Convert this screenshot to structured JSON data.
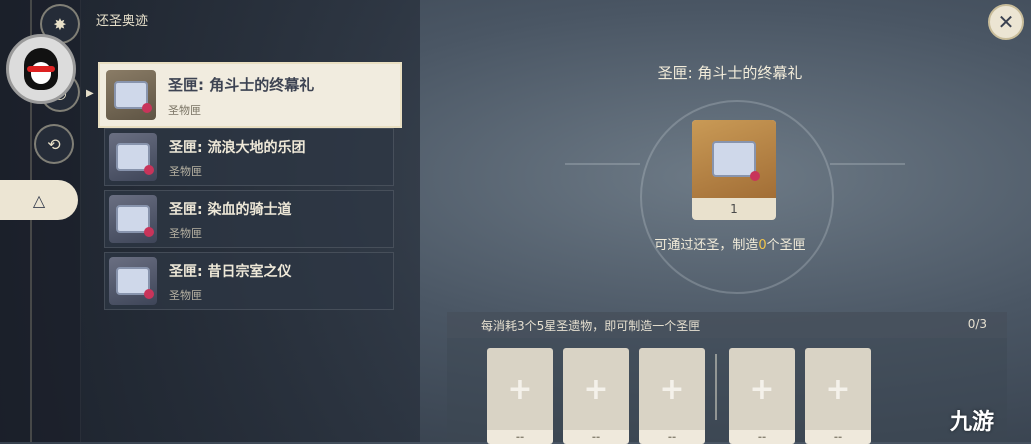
{
  "page": {
    "title": "还圣奥迹"
  },
  "list": [
    {
      "name": "圣匣: 角斗士的终幕礼",
      "type": "圣物匣",
      "selected": true
    },
    {
      "name": "圣匣: 流浪大地的乐团",
      "type": "圣物匣",
      "selected": false
    },
    {
      "name": "圣匣: 染血的骑士道",
      "type": "圣物匣",
      "selected": false
    },
    {
      "name": "圣匣: 昔日宗室之仪",
      "type": "圣物匣",
      "selected": false
    }
  ],
  "detail": {
    "title": "圣匣: 角斗士的终幕礼",
    "count": "1",
    "craft_prefix": "可通过还圣，制造",
    "craft_num": "0",
    "craft_suffix": "个圣匣"
  },
  "requirement": {
    "text": "每消耗3个5星圣遗物，即可制造一个圣匣",
    "progress": "0/3"
  },
  "slots": [
    {
      "symbol": "+",
      "label": "--"
    },
    {
      "symbol": "+",
      "label": "--"
    },
    {
      "symbol": "+",
      "label": "--"
    },
    {
      "symbol": "+",
      "label": "--"
    },
    {
      "symbol": "+",
      "label": "--"
    }
  ],
  "buttons": {
    "close": "✕"
  },
  "watermark": "九游",
  "icons": [
    "penguin-avatar-icon",
    "recycle-icon",
    "triangle-icon",
    "chest-icon"
  ]
}
